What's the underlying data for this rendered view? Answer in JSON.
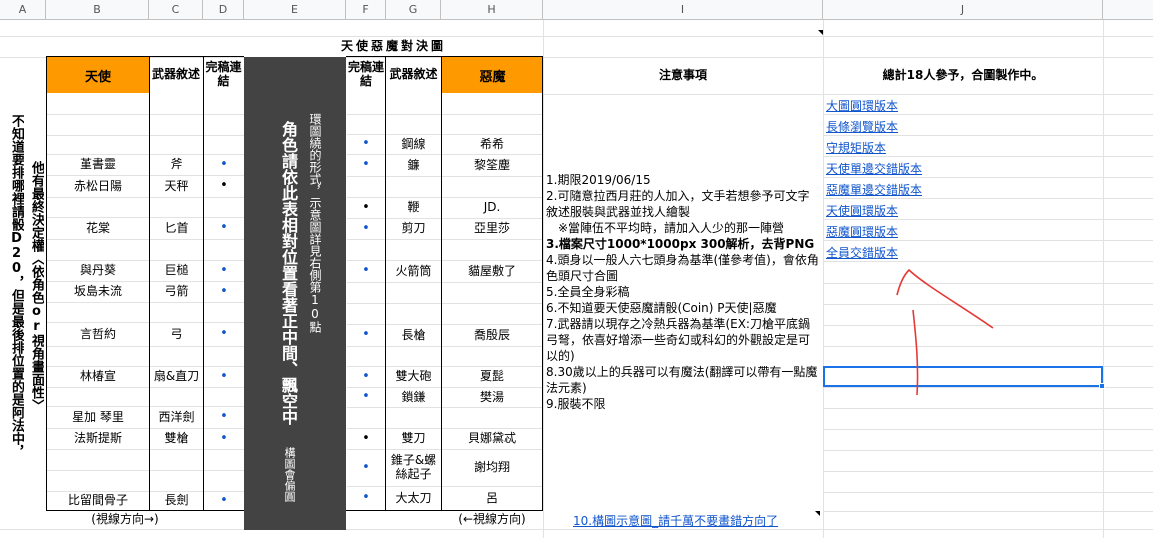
{
  "sheet": {
    "columns": [
      "A",
      "B",
      "C",
      "D",
      "E",
      "F",
      "G",
      "H",
      "I",
      "J"
    ],
    "title": "天使惡魔對決圖",
    "colors": {
      "angel_header": "#ff9900",
      "dark_band": "#434343",
      "link": "#1155cc",
      "arrow": "#e53935",
      "selection": "#1a73e8"
    }
  },
  "left_notes": {
    "col1": "他有最終決定權〈依角色or視角畫面性〉",
    "col2": "不知道要排哪裡請骰D20，但是最後排位置的是阿法中，"
  },
  "angel": {
    "header": "天使",
    "weapon_header": "武器敘述",
    "link_header": "完稿連結",
    "rows": [
      {
        "name": "",
        "weapon": "",
        "link": ""
      },
      {
        "name": "",
        "weapon": "",
        "link": ""
      },
      {
        "name": "",
        "weapon": "",
        "link": ""
      },
      {
        "name": "堇書靈",
        "weapon": "斧",
        "link": "•"
      },
      {
        "name": "赤松日陽",
        "weapon": "天秤",
        "link": "•"
      },
      {
        "name": "",
        "weapon": "",
        "link": ""
      },
      {
        "name": "花棠",
        "weapon": "匕首",
        "link": "•"
      },
      {
        "name": "",
        "weapon": "",
        "link": ""
      },
      {
        "name": "與丹葵",
        "weapon": "巨槌",
        "link": "•"
      },
      {
        "name": "坂島未流",
        "weapon": "弓箭",
        "link": "•"
      },
      {
        "name": "",
        "weapon": "",
        "link": ""
      },
      {
        "name": "言哲約",
        "weapon": "弓",
        "link": "•"
      },
      {
        "name": "",
        "weapon": "",
        "link": ""
      },
      {
        "name": "林椿宣",
        "weapon": "扇&直刀",
        "link": "•"
      },
      {
        "name": "",
        "weapon": "",
        "link": ""
      },
      {
        "name": "星加 琴里",
        "weapon": "西洋劍",
        "link": "•"
      },
      {
        "name": "法斯提斯",
        "weapon": "雙槍",
        "link": "•"
      },
      {
        "name": "",
        "weapon": "",
        "link": ""
      },
      {
        "name": "",
        "weapon": "",
        "link": ""
      },
      {
        "name": "比留間骨子",
        "weapon": "長劍",
        "link": "•"
      }
    ],
    "direction": "(視線方向→)"
  },
  "center": {
    "big": "角色請依此表相對位置看著正中間、飄空中",
    "small1": "環圖繞的形式，示意圖詳見右側第10點",
    "small2": "構圖會偏圓"
  },
  "demon": {
    "header": "惡魔",
    "weapon_header": "武器敘述",
    "link_header": "完稿連結",
    "rows": [
      {
        "name": "",
        "weapon": "",
        "link": ""
      },
      {
        "name": "",
        "weapon": "",
        "link": ""
      },
      {
        "name": "希希",
        "weapon": "鋼線",
        "link": "•"
      },
      {
        "name": "黎筌塵",
        "weapon": "鐮",
        "link": "•"
      },
      {
        "name": "",
        "weapon": "",
        "link": ""
      },
      {
        "name": "JD.",
        "weapon": "鞭",
        "link": "•"
      },
      {
        "name": "亞里莎",
        "weapon": "剪刀",
        "link": "•"
      },
      {
        "name": "",
        "weapon": "",
        "link": ""
      },
      {
        "name": "貓屋敷了",
        "weapon": "火箭筒",
        "link": "•"
      },
      {
        "name": "",
        "weapon": "",
        "link": ""
      },
      {
        "name": "",
        "weapon": "",
        "link": ""
      },
      {
        "name": "喬殷辰",
        "weapon": "長槍",
        "link": "•"
      },
      {
        "name": "",
        "weapon": "",
        "link": ""
      },
      {
        "name": "夏髭",
        "weapon": "雙大砲",
        "link": "•"
      },
      {
        "name": "樊湯",
        "weapon": "鎖鎌",
        "link": "•"
      },
      {
        "name": "",
        "weapon": "",
        "link": ""
      },
      {
        "name": "貝娜黛忒",
        "weapon": "雙刀",
        "link": "•"
      },
      {
        "name": "謝均翔",
        "weapon": "錐子&螺絲起子",
        "link": "•"
      },
      {
        "name": "呂",
        "weapon": "大太刀",
        "link": "•"
      }
    ],
    "direction": "(←視線方向)"
  },
  "notes": {
    "header": "注意事項",
    "items": [
      "1.期限2019/06/15",
      "2.可隨意拉西月莊的人加入，文手若想參予可文字敘述服裝與武器並找人繪製",
      "※當陣伍不平均時，請加入人少的那一陣營",
      "3.檔案尺寸1000*1000px 300解析，去背PNG",
      "4.頭身以一般人六七頭身為基準(僅參考值)，會依角色頭尺寸合圖",
      "5.全員全身彩稿",
      "6.不知道要天使惡魔請骰(Coin) P天使|惡魔",
      "7.武器請以現存之冷熱兵器為基準(EX:刀槍平底鍋弓弩，依喜好增添一些奇幻或科幻的外觀設定是可以的)",
      "8.30歲以上的兵器可以有魔法(翻譯可以帶有一點魔法元素)",
      "9.服裝不限"
    ],
    "link10": "10.構圖示意圖_請千萬不要畫錯方向了"
  },
  "summary": {
    "header": "總計18人參予，合圖製作中。",
    "links": [
      "大圖圓環版本",
      "長條瀏覽版本",
      "守規矩版本",
      "天使單邊交錯版本",
      "惡魔單邊交錯版本",
      "天使圓環版本",
      "惡魔圓環版本",
      "全員交錯版本"
    ]
  }
}
